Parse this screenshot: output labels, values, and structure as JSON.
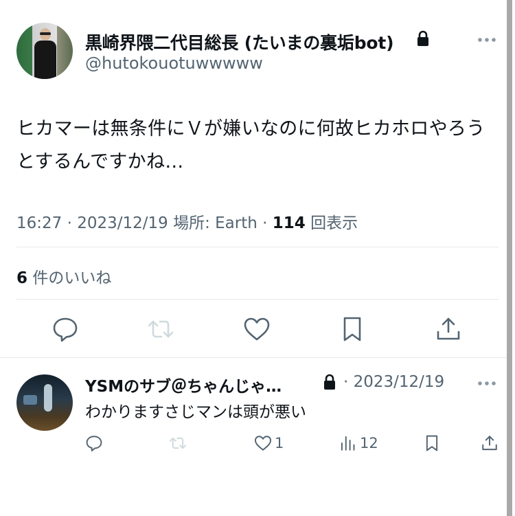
{
  "tweet": {
    "display_name": "黒崎界隈二代目総長 (たいまの裏垢bot)",
    "handle": "@hutokouotuwwwww",
    "text": "ヒカマーは無条件にＶが嫌いなのに何故ヒカホロやろうとするんですかね…",
    "time": "16:27 · 2023/12/19 場所: Earth · ",
    "views_count": "114",
    "views_label": " 回表示",
    "likes_count": "6",
    "likes_label": " 件のいいね",
    "icons": {
      "lock": "lock-icon",
      "more": "more-icon",
      "reply": "reply-icon",
      "retweet": "retweet-icon",
      "like": "heart-icon",
      "bookmark": "bookmark-icon",
      "share": "share-icon"
    }
  },
  "reply": {
    "display_name": "YSMのサブ＠ちゃんじゃ…",
    "date": "· 2023/12/19",
    "text": "わかりますさじマンは頭が悪い",
    "like_count": "1",
    "views_count": "12",
    "icons": {
      "lock": "lock-icon",
      "more": "more-icon",
      "reply": "reply-icon",
      "retweet": "retweet-icon",
      "like": "heart-icon",
      "views": "views-icon",
      "bookmark": "bookmark-icon",
      "share": "share-icon"
    }
  },
  "colors": {
    "text": "#0f1419",
    "secondary": "#536471",
    "divider": "#e7e9ea",
    "disabled": "#cfd9de"
  }
}
